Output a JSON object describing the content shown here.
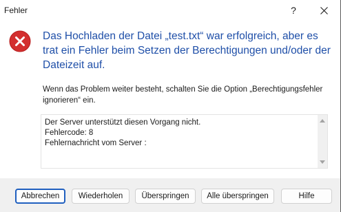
{
  "window": {
    "title": "Fehler"
  },
  "titlebar": {
    "help_label": "?"
  },
  "message": {
    "main": "Das Hochladen der Datei „test.txt“ war erfolgreich, aber es trat ein Fehler beim Setzen der Berechtigungen und/oder der Dateizeit auf.",
    "sub": "Wenn das Problem weiter besteht, schalten Sie die Option „Berechtigungsfehler ignorieren“ ein."
  },
  "details": {
    "text": "Der Server unterstützt diesen Vorgang nicht.\nFehlercode: 8\nFehlernachricht vom Server :"
  },
  "buttons": {
    "cancel": "Abbrechen",
    "retry": "Wiederholen",
    "skip": "Überspringen",
    "skip_all": "Alle überspringen",
    "help": "Hilfe"
  },
  "colors": {
    "error_red": "#d32f2f",
    "message_blue": "#1f4fa8",
    "focus_border": "#1f5fbf"
  },
  "icons": {
    "error": "error-icon",
    "close": "close-icon",
    "help": "help-icon"
  }
}
